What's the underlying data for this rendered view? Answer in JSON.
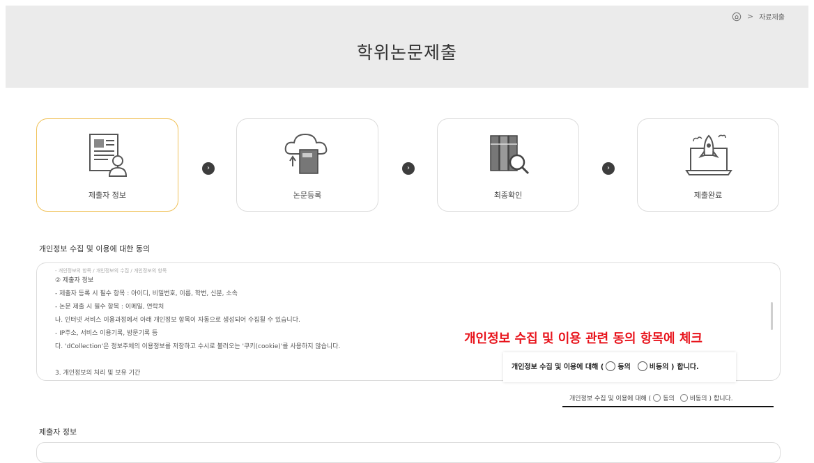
{
  "breadcrumb": {
    "home_icon": "home-icon",
    "separator": ">",
    "current": "자료제출"
  },
  "page_title": "학위논문제출",
  "steps": [
    {
      "label": "제출자 정보",
      "icon": "document-person-icon",
      "active": true
    },
    {
      "label": "논문등록",
      "icon": "cloud-upload-book-icon",
      "active": false
    },
    {
      "label": "최종확인",
      "icon": "binders-magnifier-icon",
      "active": false
    },
    {
      "label": "제출완료",
      "icon": "laptop-rocket-icon",
      "active": false
    }
  ],
  "step_arrow": "›",
  "consent": {
    "title": "개인정보 수집 및 이용에 대한 동의",
    "lines": [
      "- 개인정보의 항목 / 개인정보의 수집 / 개인정보의 항목",
      "② 제출자 정보",
      "- 제출자 등록 시 필수 항목 : 아이디, 비밀번호, 이름, 학번, 신분, 소속",
      "- 논문 제출 시 필수 항목 : 이메일, 연락처",
      "나. 인터넷 서비스 이용과정에서 아래 개인정보 항목이 자동으로 생성되어 수집될 수 있습니다.",
      "- IP주소, 서비스 이용기록, 방문기록 등",
      "다. 'dCollection'은 정보주체의 이용정보를 저장하고 수시로 불러오는 '쿠키(cookie)'를 사용하지 않습니다.",
      "",
      "3. 개인정보의 처리 및 보유 기간"
    ],
    "agree_prefix": "개인정보 수집 및 이용에 대해 (",
    "agree_label": "동의",
    "disagree_label": "비동의 )",
    "agree_suffix": "합니다."
  },
  "annotation": {
    "text": "개인정보 수집 및 이용 관련 동의 항목에 체크",
    "color": "#e8141c"
  },
  "submitter_section_title": "제출자 정보",
  "colors": {
    "accent_border": "#f0c25a",
    "header_bg": "#ebebeb",
    "arrow_bg": "#3d3d3d"
  }
}
